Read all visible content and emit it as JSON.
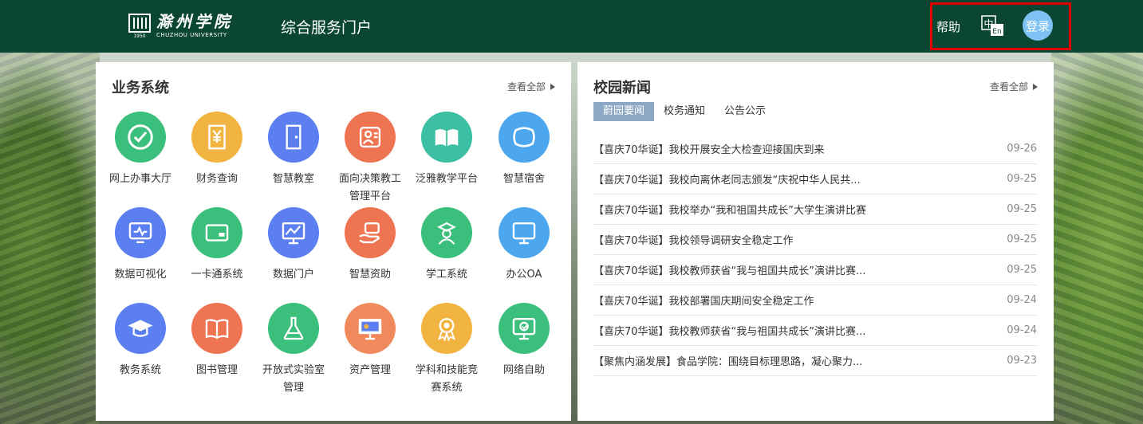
{
  "header": {
    "logo_cn": "滁州学院",
    "logo_en": "CHUZHOU UNIVERSITY",
    "logo_year": "1950",
    "portal_title": "综合服务门户",
    "help": "帮助",
    "lang_icon_text": "中",
    "lang_icon_sub": "En",
    "login": "登录",
    "highlight_color": "#e30000"
  },
  "business": {
    "title": "业务系统",
    "view_all": "查看全部",
    "apps": [
      {
        "label": "网上办事大厅",
        "color": "#3bbf7d",
        "icon": "check-circle-icon"
      },
      {
        "label": "财务查询",
        "color": "#f2b441",
        "icon": "yen-receipt-icon"
      },
      {
        "label": "智慧教室",
        "color": "#5b7ff0",
        "icon": "door-icon"
      },
      {
        "label": "面向决策教工管理平台",
        "color": "#ef7552",
        "icon": "person-card-icon"
      },
      {
        "label": "泛雅教学平台",
        "color": "#3dbfa3",
        "icon": "open-book-icon"
      },
      {
        "label": "智慧宿舍",
        "color": "#4ca7ef",
        "icon": "pillow-icon"
      },
      {
        "label": "数据可视化",
        "color": "#5b7ff0",
        "icon": "pulse-monitor-icon"
      },
      {
        "label": "一卡通系统",
        "color": "#3bbf7d",
        "icon": "card-icon"
      },
      {
        "label": "数据门户",
        "color": "#5b7ff0",
        "icon": "chart-monitor-icon"
      },
      {
        "label": "智慧资助",
        "color": "#ef7552",
        "icon": "hand-card-icon"
      },
      {
        "label": "学工系统",
        "color": "#3bbf7d",
        "icon": "graduate-icon"
      },
      {
        "label": "办公OA",
        "color": "#4ca7ef",
        "icon": "monitor-icon"
      },
      {
        "label": "教务系统",
        "color": "#5b7ff0",
        "icon": "mortarboard-icon"
      },
      {
        "label": "图书管理",
        "color": "#ef7552",
        "icon": "book-icon"
      },
      {
        "label": "开放式实验室管理",
        "color": "#3bbf7d",
        "icon": "flask-icon"
      },
      {
        "label": "资产管理",
        "color": "#f08a5d",
        "icon": "asset-monitor-icon"
      },
      {
        "label": "学科和技能竞赛系统",
        "color": "#f2b441",
        "icon": "medal-icon"
      },
      {
        "label": "网络自助",
        "color": "#3bbf7d",
        "icon": "network-monitor-icon"
      }
    ]
  },
  "news": {
    "title": "校园新闻",
    "view_all": "查看全部",
    "tabs": [
      "蔚园要闻",
      "校务通知",
      "公告公示"
    ],
    "active_tab": 0,
    "items": [
      {
        "title": "【喜庆70华诞】我校开展安全大检查迎接国庆到来",
        "date": "09-26"
      },
      {
        "title": "【喜庆70华诞】我校向离休老同志颁发“庆祝中华人民共...",
        "date": "09-25"
      },
      {
        "title": "【喜庆70华诞】我校举办“我和祖国共成长”大学生演讲比赛",
        "date": "09-25"
      },
      {
        "title": "【喜庆70华诞】我校领导调研安全稳定工作",
        "date": "09-25"
      },
      {
        "title": "【喜庆70华诞】我校教师获省“我与祖国共成长”演讲比赛...",
        "date": "09-25"
      },
      {
        "title": "【喜庆70华诞】我校部署国庆期间安全稳定工作",
        "date": "09-24"
      },
      {
        "title": "【喜庆70华诞】我校教师获省“我与祖国共成长”演讲比赛...",
        "date": "09-24"
      },
      {
        "title": "【聚焦内涵发展】食品学院：围绕目标理思路，凝心聚力...",
        "date": "09-23"
      }
    ]
  }
}
